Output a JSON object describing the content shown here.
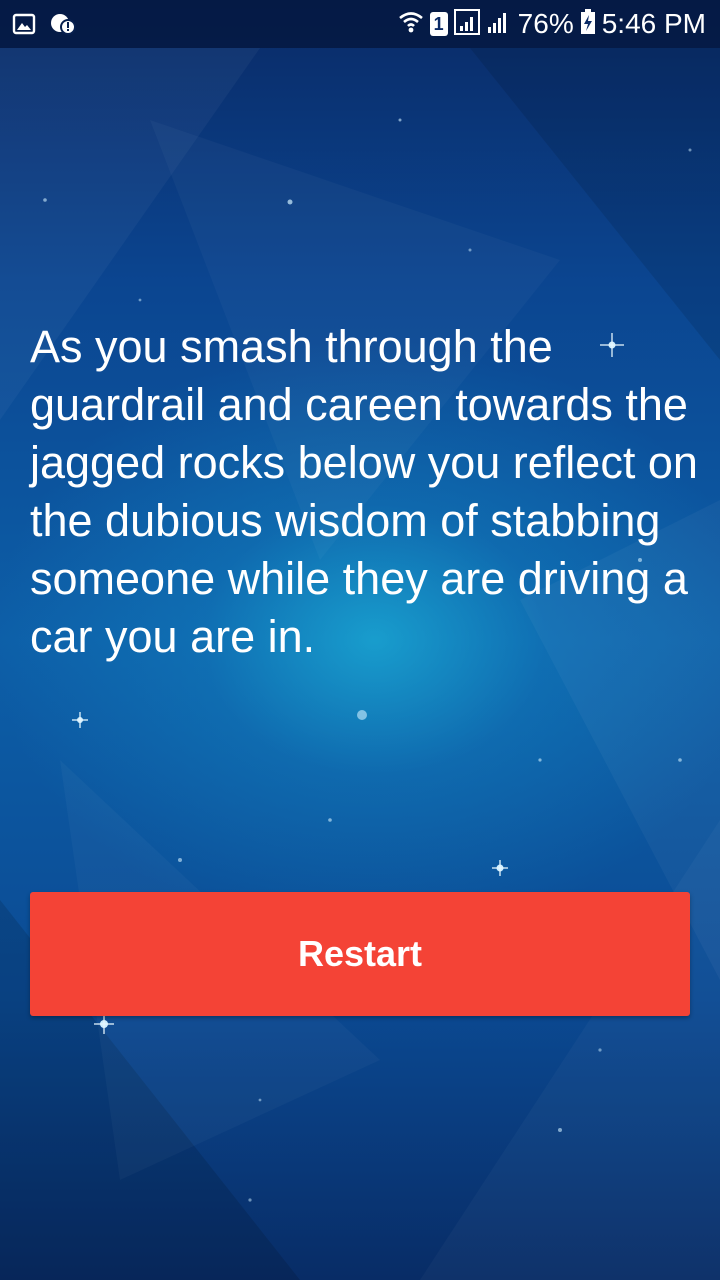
{
  "status_bar": {
    "left_icons": [
      "gallery-icon",
      "alert-icon"
    ],
    "right_icons": [
      "wifi-icon",
      "sim-icon",
      "signal-icon",
      "signal-icon",
      "battery-charging-icon"
    ],
    "sim_number": "1",
    "battery": "76%",
    "time": "5:46 PM"
  },
  "story": {
    "text": "As you smash through the guardrail and careen towards the jagged rocks below you reflect on the dubious wisdom of stabbing someone while they are driving a car you are in."
  },
  "actions": {
    "restart_label": "Restart"
  },
  "colors": {
    "button_background": "#f44336",
    "background_top": "#0a2a66",
    "background_glow": "#1ebee1",
    "text": "#ffffff"
  }
}
